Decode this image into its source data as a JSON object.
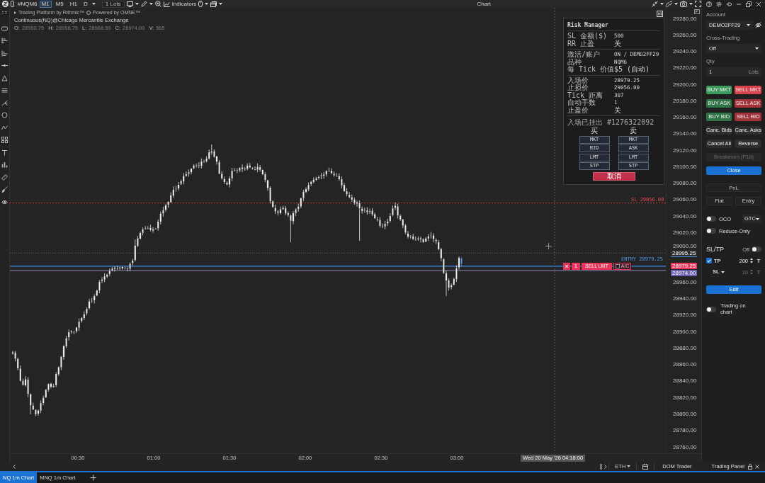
{
  "toolbar": {
    "symbol": "#NQM6",
    "timeframes": [
      {
        "label": "M1",
        "selected": true
      },
      {
        "label": "M5",
        "selected": false
      },
      {
        "label": "H1",
        "selected": false
      },
      {
        "label": "D",
        "selected": false
      }
    ],
    "lots": "1 Lots",
    "indicators": "Indicators",
    "title": "Chart"
  },
  "legend": {
    "credits": [
      "Trading Platform by Rithmic™",
      "Powered by OMNE™"
    ],
    "instrument": "Continuous(NQ)@Chicago Mercantile Exchange",
    "ohlcv": [
      {
        "label": "O:",
        "value": "28990.75"
      },
      {
        "label": "H:",
        "value": "28996.75"
      },
      {
        "label": "L:",
        "value": "28968.50"
      },
      {
        "label": "C:",
        "value": "28974.00"
      },
      {
        "label": "V:",
        "value": "565"
      }
    ]
  },
  "risk_manager": {
    "title": "Risk Manager",
    "sections": [
      [
        {
          "label": "SL 金额($)",
          "value": "500"
        },
        {
          "label": "RR 止盈",
          "value": "关"
        }
      ],
      [
        {
          "label": "激活/账户",
          "value": "ON / DEMO2FF29"
        },
        {
          "label": "品种",
          "value": "NQM6"
        },
        {
          "label": "每 Tick 价值",
          "value": "$5 (自动)"
        }
      ],
      [
        {
          "label": "入场价",
          "value": "28979.25"
        },
        {
          "label": "止损价",
          "value": "29056.00"
        },
        {
          "label": "Tick 距离",
          "value": "307"
        },
        {
          "label": "自动手数",
          "value": "1"
        },
        {
          "label": "止盈价",
          "value": "关"
        }
      ]
    ],
    "status": "入场已挂出 #1276322092",
    "sides": [
      {
        "header": "买",
        "buttons": [
          "MKT",
          "BID",
          "LMT",
          "STP"
        ]
      },
      {
        "header": "卖",
        "buttons": [
          "MKT",
          "ASK",
          "LMT",
          "STP"
        ]
      }
    ],
    "cancel": "取消"
  },
  "chart": {
    "lines": [
      {
        "kind": "stop",
        "label": "SL 29056.00"
      },
      {
        "kind": "entry",
        "label": "ENTRY 28979.25"
      }
    ],
    "order": {
      "qty": "1",
      "label": "SELL LMT",
      "auto_close": {
        "label": "A/C",
        "checked": false
      }
    }
  },
  "price_axis": {
    "ticks": [
      "29280.00",
      "29260.00",
      "29240.00",
      "29220.00",
      "29200.00",
      "29180.00",
      "29160.00",
      "29140.00",
      "29120.00",
      "29100.00",
      "29080.00",
      "29060.00",
      "29040.00",
      "29020.00",
      "29000.00",
      "28960.00",
      "28940.00",
      "28920.00",
      "28900.00",
      "28880.00",
      "28860.00",
      "28840.00",
      "28820.00",
      "28800.00",
      "28780.00",
      "28760.00"
    ],
    "badges": [
      {
        "kind": "last",
        "label": "28995.25"
      },
      {
        "kind": "entry",
        "label": "28979.25"
      },
      {
        "kind": "current",
        "label": "28974.00"
      }
    ]
  },
  "time_axis": {
    "ticks": [
      "00:30",
      "01:00",
      "01:30",
      "02:00",
      "02:30",
      "03:00"
    ],
    "cursor": "Wed 20 May '26 04:18:00"
  },
  "trading_panel": {
    "account": {
      "label": "Account",
      "value": "DEMO2FF29"
    },
    "cross_trading": {
      "label": "Cross-Trading",
      "value": "Off"
    },
    "qty": {
      "label": "Qty",
      "value": "1",
      "unit": "Lots"
    },
    "order_buttons": [
      {
        "label": "BUY MKT",
        "color": "#3d9a5c",
        "disabled": false
      },
      {
        "label": "SELL MKT",
        "color": "#d8434d",
        "disabled": false
      },
      {
        "label": "BUY ASK",
        "color": "#2f7446",
        "disabled": false
      },
      {
        "label": "SELL ASK",
        "color": "#a3313a",
        "disabled": false
      },
      {
        "label": "BUY BID",
        "color": "#2f7446",
        "disabled": false
      },
      {
        "label": "SELL BID",
        "color": "#a3313a",
        "disabled": false
      },
      {
        "label": "Canc. Bids",
        "color": "#2e2e2e",
        "disabled": false
      },
      {
        "label": "Canc. Asks",
        "color": "#2e2e2e",
        "disabled": false
      },
      {
        "label": "Cancel All",
        "color": "#2e2e2e",
        "disabled": false
      },
      {
        "label": "Reverse",
        "color": "#2e2e2e",
        "disabled": false
      }
    ],
    "wide_buttons": [
      {
        "label": "Breakeven (F18)",
        "color": "#272727",
        "disabled": true
      },
      {
        "label": "Close",
        "color": "#1a73d4",
        "disabled": false
      }
    ],
    "pnl": {
      "title": "PnL",
      "options": [
        "Flat",
        "Entry"
      ]
    },
    "oco": {
      "label": "OCO",
      "on": false
    },
    "time_in_force": "GTC",
    "reduce_only": {
      "label": "Reduce-Only",
      "on": false
    },
    "sl_tp": {
      "label": "SL/TP",
      "status": "Off",
      "on": false,
      "tp": {
        "label": "TP",
        "checked": true,
        "value": "200",
        "unit": "T",
        "disabled": false
      },
      "sl": {
        "label": "SL",
        "value": "10",
        "unit": "T",
        "disabled": true
      }
    },
    "edit": "Edit",
    "trading_on_chart": {
      "label": "Trading on chart",
      "on": false
    }
  },
  "bottom_bar": {
    "session": "ETH",
    "items": [
      "DOM Trader",
      "Trading Panel"
    ]
  },
  "tabs": [
    {
      "label": "NQ 1m Chart",
      "selected": true
    },
    {
      "label": "MNQ 1m Chart",
      "selected": false
    }
  ]
}
